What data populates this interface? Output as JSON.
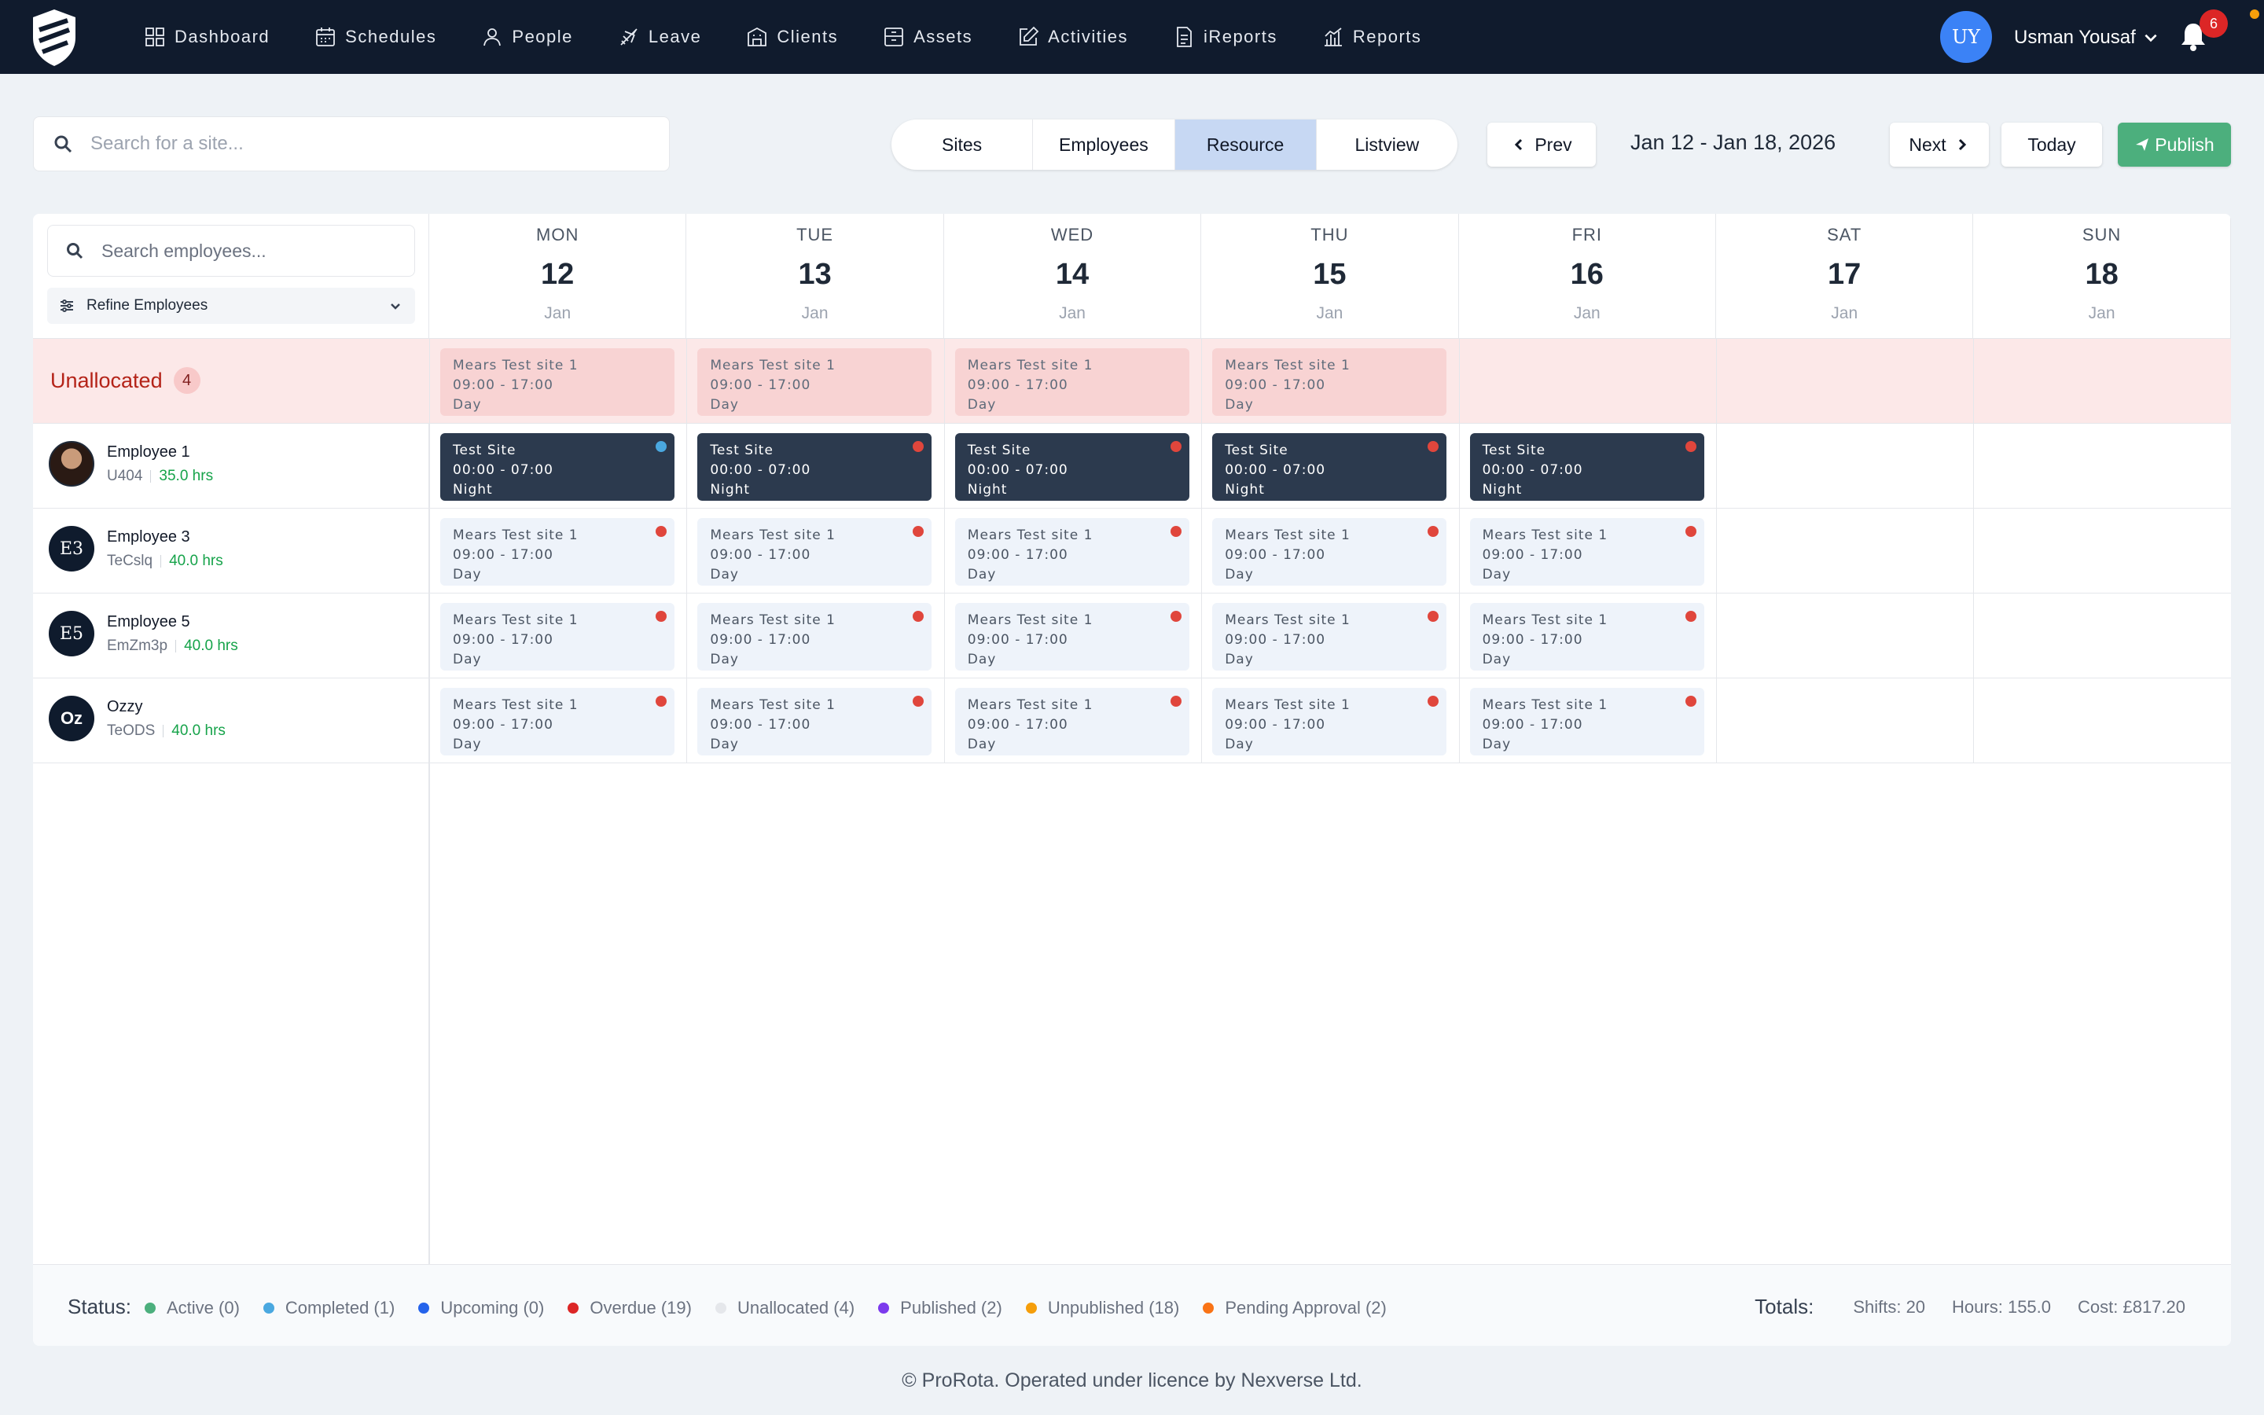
{
  "nav": {
    "items": [
      {
        "label": "Dashboard",
        "icon": "dashboard-icon"
      },
      {
        "label": "Schedules",
        "icon": "calendar-icon"
      },
      {
        "label": "People",
        "icon": "person-icon"
      },
      {
        "label": "Leave",
        "icon": "plane-icon"
      },
      {
        "label": "Clients",
        "icon": "building-icon"
      },
      {
        "label": "Assets",
        "icon": "box-icon"
      },
      {
        "label": "Activities",
        "icon": "edit-icon"
      },
      {
        "label": "iReports",
        "icon": "document-icon"
      },
      {
        "label": "Reports",
        "icon": "bar-chart-icon"
      }
    ],
    "user_initials": "UY",
    "user_name": "Usman Yousaf",
    "notification_count": "6"
  },
  "toolbar": {
    "site_search_placeholder": "Search for a site...",
    "tabs": [
      "Sites",
      "Employees",
      "Resource",
      "Listview"
    ],
    "active_tab": "Resource",
    "prev_label": "Prev",
    "date_range": "Jan 12 - Jan 18, 2026",
    "next_label": "Next",
    "today_label": "Today",
    "publish_label": "Publish"
  },
  "sidebar": {
    "employee_search_placeholder": "Search employees...",
    "refine_label": "Refine Employees"
  },
  "days": [
    {
      "name": "MON",
      "date": "12",
      "month": "Jan"
    },
    {
      "name": "TUE",
      "date": "13",
      "month": "Jan"
    },
    {
      "name": "WED",
      "date": "14",
      "month": "Jan"
    },
    {
      "name": "THU",
      "date": "15",
      "month": "Jan"
    },
    {
      "name": "FRI",
      "date": "16",
      "month": "Jan"
    },
    {
      "name": "SAT",
      "date": "17",
      "month": "Jan"
    },
    {
      "name": "SUN",
      "date": "18",
      "month": "Jan"
    }
  ],
  "unallocated": {
    "label": "Unallocated",
    "count": "4",
    "shifts": [
      {
        "site": "Mears Test site 1",
        "time": "09:00 - 17:00",
        "type": "Day"
      },
      {
        "site": "Mears Test site 1",
        "time": "09:00 - 17:00",
        "type": "Day"
      },
      {
        "site": "Mears Test site 1",
        "time": "09:00 - 17:00",
        "type": "Day"
      },
      {
        "site": "Mears Test site 1",
        "time": "09:00 - 17:00",
        "type": "Day"
      }
    ]
  },
  "employees": [
    {
      "name": "Employee 1",
      "code": "U404",
      "hours": "35.0 hrs",
      "avatar": "photo",
      "initials": "",
      "shifts": [
        {
          "site": "Test Site",
          "time": "00:00 - 07:00",
          "type": "Night",
          "style": "dark",
          "dot": "#4aa8e0"
        },
        {
          "site": "Test Site",
          "time": "00:00 - 07:00",
          "type": "Night",
          "style": "dark",
          "dot": "#e0463c"
        },
        {
          "site": "Test Site",
          "time": "00:00 - 07:00",
          "type": "Night",
          "style": "dark",
          "dot": "#e0463c"
        },
        {
          "site": "Test Site",
          "time": "00:00 - 07:00",
          "type": "Night",
          "style": "dark",
          "dot": "#e0463c"
        },
        {
          "site": "Test Site",
          "time": "00:00 - 07:00",
          "type": "Night",
          "style": "dark",
          "dot": "#e0463c"
        }
      ]
    },
    {
      "name": "Employee 3",
      "code": "TeCslq",
      "hours": "40.0 hrs",
      "avatar": "initials",
      "initials": "E3",
      "shifts": [
        {
          "site": "Mears Test site 1",
          "time": "09:00 - 17:00",
          "type": "Day",
          "style": "light",
          "dot": "#e0463c"
        },
        {
          "site": "Mears Test site 1",
          "time": "09:00 - 17:00",
          "type": "Day",
          "style": "light",
          "dot": "#e0463c"
        },
        {
          "site": "Mears Test site 1",
          "time": "09:00 - 17:00",
          "type": "Day",
          "style": "light",
          "dot": "#e0463c"
        },
        {
          "site": "Mears Test site 1",
          "time": "09:00 - 17:00",
          "type": "Day",
          "style": "light",
          "dot": "#e0463c"
        },
        {
          "site": "Mears Test site 1",
          "time": "09:00 - 17:00",
          "type": "Day",
          "style": "light",
          "dot": "#e0463c"
        }
      ]
    },
    {
      "name": "Employee 5",
      "code": "EmZm3p",
      "hours": "40.0 hrs",
      "avatar": "initials",
      "initials": "E5",
      "shifts": [
        {
          "site": "Mears Test site 1",
          "time": "09:00 - 17:00",
          "type": "Day",
          "style": "light",
          "dot": "#e0463c"
        },
        {
          "site": "Mears Test site 1",
          "time": "09:00 - 17:00",
          "type": "Day",
          "style": "light",
          "dot": "#e0463c"
        },
        {
          "site": "Mears Test site 1",
          "time": "09:00 - 17:00",
          "type": "Day",
          "style": "light",
          "dot": "#e0463c"
        },
        {
          "site": "Mears Test site 1",
          "time": "09:00 - 17:00",
          "type": "Day",
          "style": "light",
          "dot": "#e0463c"
        },
        {
          "site": "Mears Test site 1",
          "time": "09:00 - 17:00",
          "type": "Day",
          "style": "light",
          "dot": "#e0463c"
        }
      ]
    },
    {
      "name": "Ozzy",
      "code": "TeODS",
      "hours": "40.0 hrs",
      "avatar": "initials",
      "initials": "Oz",
      "shifts": [
        {
          "site": "Mears Test site 1",
          "time": "09:00 - 17:00",
          "type": "Day",
          "style": "light",
          "dot": "#e0463c"
        },
        {
          "site": "Mears Test site 1",
          "time": "09:00 - 17:00",
          "type": "Day",
          "style": "light",
          "dot": "#e0463c"
        },
        {
          "site": "Mears Test site 1",
          "time": "09:00 - 17:00",
          "type": "Day",
          "style": "light",
          "dot": "#e0463c"
        },
        {
          "site": "Mears Test site 1",
          "time": "09:00 - 17:00",
          "type": "Day",
          "style": "light",
          "dot": "#e0463c"
        },
        {
          "site": "Mears Test site 1",
          "time": "09:00 - 17:00",
          "type": "Day",
          "style": "light",
          "dot": "#e0463c"
        }
      ]
    }
  ],
  "status": {
    "label": "Status:",
    "items": [
      {
        "label": "Active (0)",
        "color": "#4caf7d"
      },
      {
        "label": "Completed (1)",
        "color": "#4aa8e0"
      },
      {
        "label": "Upcoming (0)",
        "color": "#2563eb"
      },
      {
        "label": "Overdue (19)",
        "color": "#dc2626"
      },
      {
        "label": "Unallocated (4)",
        "color": "#e5e7eb"
      },
      {
        "label": "Published (2)",
        "color": "#7c3aed"
      },
      {
        "label": "Unpublished (18)",
        "color": "#f59e0b"
      },
      {
        "label": "Pending Approval (2)",
        "color": "#f97316"
      }
    ]
  },
  "totals": {
    "label": "Totals:",
    "shifts": "Shifts: 20",
    "hours": "Hours: 155.0",
    "cost": "Cost: £817.20"
  },
  "footer": {
    "copyright": "© ProRota. Operated under licence by Nexverse Ltd."
  },
  "colors": {
    "nav_bg": "#101b2d",
    "accent_blue": "#3b82f6",
    "publish_green": "#4caf7d",
    "unallocated_bg": "#fce8e8"
  }
}
